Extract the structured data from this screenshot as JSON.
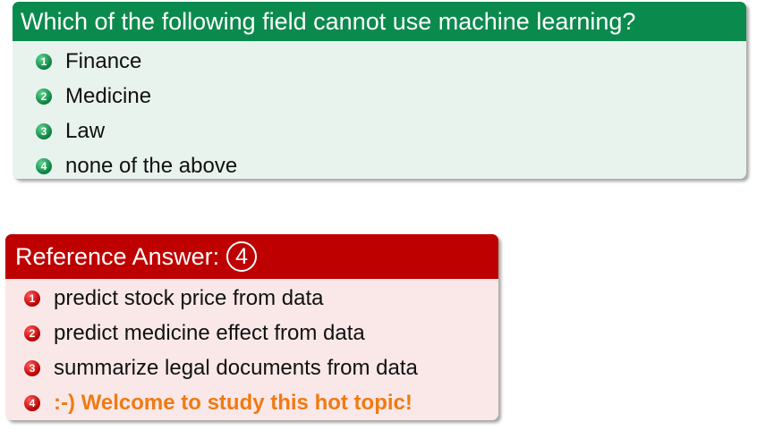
{
  "question": {
    "title": "Which of the following field cannot use machine learning?",
    "options": [
      {
        "number": "1",
        "text": "Finance"
      },
      {
        "number": "2",
        "text": "Medicine"
      },
      {
        "number": "3",
        "text": "Law"
      },
      {
        "number": "4",
        "text": "none of the above"
      }
    ]
  },
  "answer": {
    "title": "Reference Answer:",
    "answer_value": "4",
    "explanations": [
      {
        "number": "1",
        "text": "predict stock price from data"
      },
      {
        "number": "2",
        "text": "predict medicine effect from data"
      },
      {
        "number": "3",
        "text": "summarize legal documents from data"
      },
      {
        "number": "4",
        "text": ":-) Welcome to study this hot topic!"
      }
    ]
  },
  "colors": {
    "question_header": "#0b8a4d",
    "question_body": "#e8f3ee",
    "answer_header": "#be0000",
    "answer_body": "#fae8e8",
    "highlight_text": "#f07a12"
  }
}
